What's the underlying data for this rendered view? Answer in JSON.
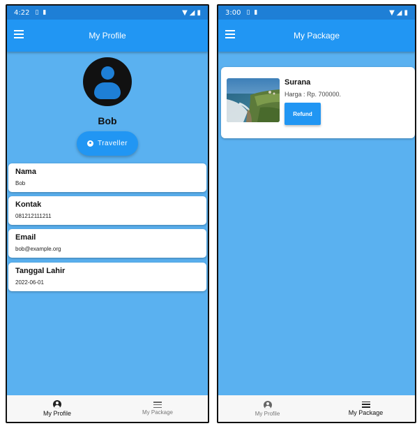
{
  "profile_screen": {
    "status_bar": {
      "time": "4:22"
    },
    "app_bar": {
      "title": "My Profile"
    },
    "user": {
      "name": "Bob",
      "role_button": "Traveller"
    },
    "fields": [
      {
        "label": "Nama",
        "value": "Bob"
      },
      {
        "label": "Kontak",
        "value": "081212111211"
      },
      {
        "label": "Email",
        "value": "bob@example.org"
      },
      {
        "label": "Tanggal Lahir",
        "value": "2022-06-01"
      }
    ],
    "bottom_nav": [
      {
        "label": "My Profile",
        "icon": "person-icon",
        "active": true
      },
      {
        "label": "My Package",
        "icon": "list-icon",
        "active": false
      }
    ]
  },
  "package_screen": {
    "status_bar": {
      "time": "3:00"
    },
    "app_bar": {
      "title": "My Package"
    },
    "package": {
      "title": "Surana",
      "price": "Harga : Rp. 700000.",
      "refund_label": "Refund",
      "image": "coastal-cliff-image"
    },
    "bottom_nav": [
      {
        "label": "My Profile",
        "icon": "person-icon",
        "active": false
      },
      {
        "label": "My Package",
        "icon": "list-icon",
        "active": true
      }
    ]
  },
  "colors": {
    "app_bar": "#2196f3",
    "status_bar": "#1e7fd6",
    "background": "#5ab1f0",
    "card": "#ffffff",
    "bottom_nav": "#f7f7f7"
  }
}
